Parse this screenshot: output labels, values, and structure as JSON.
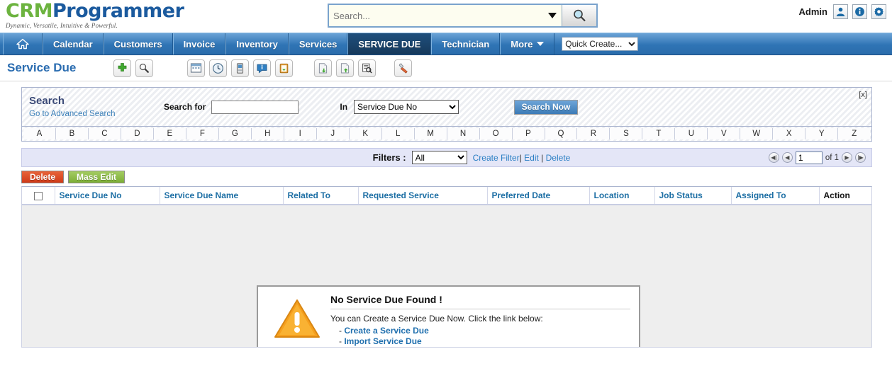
{
  "header": {
    "logo_primary": "CRM",
    "logo_secondary": "Programmer",
    "tagline": "Dynamic, Versatile, Intuitive & Powerful.",
    "search_placeholder": "Search...",
    "search_value": "",
    "search_button_icon": "magnifier-icon",
    "dropdown_icon": "caret-down-icon",
    "user_label": "Admin",
    "icons": [
      {
        "name": "user-icon"
      },
      {
        "name": "info-icon"
      },
      {
        "name": "gear-icon"
      }
    ]
  },
  "nav": {
    "home_icon": "home-icon",
    "items": [
      {
        "label": "Calendar",
        "active": false
      },
      {
        "label": "Customers",
        "active": false
      },
      {
        "label": "Invoice",
        "active": false
      },
      {
        "label": "Inventory",
        "active": false
      },
      {
        "label": "Services",
        "active": false
      },
      {
        "label": "SERVICE DUE",
        "active": true
      },
      {
        "label": "Technician",
        "active": false
      },
      {
        "label": "More",
        "active": false,
        "has_caret": true
      }
    ],
    "quick_create": {
      "selected": "Quick Create...",
      "options": [
        "Quick Create..."
      ]
    }
  },
  "page": {
    "title": "Service Due"
  },
  "toolbar": {
    "group1": [
      {
        "name": "add-icon",
        "glyph": "plus"
      },
      {
        "name": "search-record-icon",
        "glyph": "magnifier"
      }
    ],
    "group2": [
      {
        "name": "calendar-icon",
        "glyph": "calendar"
      },
      {
        "name": "clock-icon",
        "glyph": "clock"
      },
      {
        "name": "device-icon",
        "glyph": "device"
      },
      {
        "name": "chat-icon",
        "glyph": "chat"
      },
      {
        "name": "clipboard-icon",
        "glyph": "clipboard"
      }
    ],
    "group3": [
      {
        "name": "import-icon",
        "glyph": "import"
      },
      {
        "name": "export-icon",
        "glyph": "export"
      },
      {
        "name": "document-search-icon",
        "glyph": "doc-search"
      }
    ],
    "group4": [
      {
        "name": "tools-icon",
        "glyph": "tools"
      }
    ]
  },
  "search_panel": {
    "title": "Search",
    "advanced_link": "Go to Advanced Search",
    "search_for_label": "Search for",
    "search_for_value": "",
    "in_label": "In",
    "in_selected": "Service Due No",
    "in_options": [
      "Service Due No"
    ],
    "search_button": "Search Now",
    "close_label": "[x]"
  },
  "alphabet": [
    "A",
    "B",
    "C",
    "D",
    "E",
    "F",
    "G",
    "H",
    "I",
    "J",
    "K",
    "L",
    "M",
    "N",
    "O",
    "P",
    "Q",
    "R",
    "S",
    "T",
    "U",
    "V",
    "W",
    "X",
    "Y",
    "Z"
  ],
  "filters": {
    "label": "Filters :",
    "selected": "All",
    "options": [
      "All"
    ],
    "create_link": "Create Filter",
    "sep1": "|",
    "edit_link": "Edit",
    "sep2": "|",
    "delete_link": "Delete"
  },
  "pager": {
    "first_icon": "first-page-icon",
    "prev_icon": "previous-page-icon",
    "current_page": "1",
    "of_text": "of 1",
    "next_icon": "next-page-icon",
    "last_icon": "last-page-icon"
  },
  "actions": {
    "delete_label": "Delete",
    "mass_edit_label": "Mass Edit"
  },
  "table": {
    "columns": [
      "Service Due No",
      "Service Due Name",
      "Related To",
      "Requested Service",
      "Preferred Date",
      "Location",
      "Job Status",
      "Assigned To",
      "Action"
    ],
    "rows": []
  },
  "empty_state": {
    "icon": "warning-triangle-icon",
    "title": "No Service Due Found !",
    "text": "You can Create a Service Due Now. Click the link below:",
    "dash": "-",
    "link1": "Create a Service Due",
    "link2": "Import Service Due"
  },
  "colors": {
    "brand_green": "#6cb33f",
    "brand_blue": "#1b5a9e",
    "nav_blue": "#2f74b5",
    "nav_active": "#1f4f7d",
    "header_link": "#1c6ea4",
    "delete_red": "#cf3a18",
    "massedit_green": "#7cae36",
    "warning_orange": "#f5a623"
  }
}
